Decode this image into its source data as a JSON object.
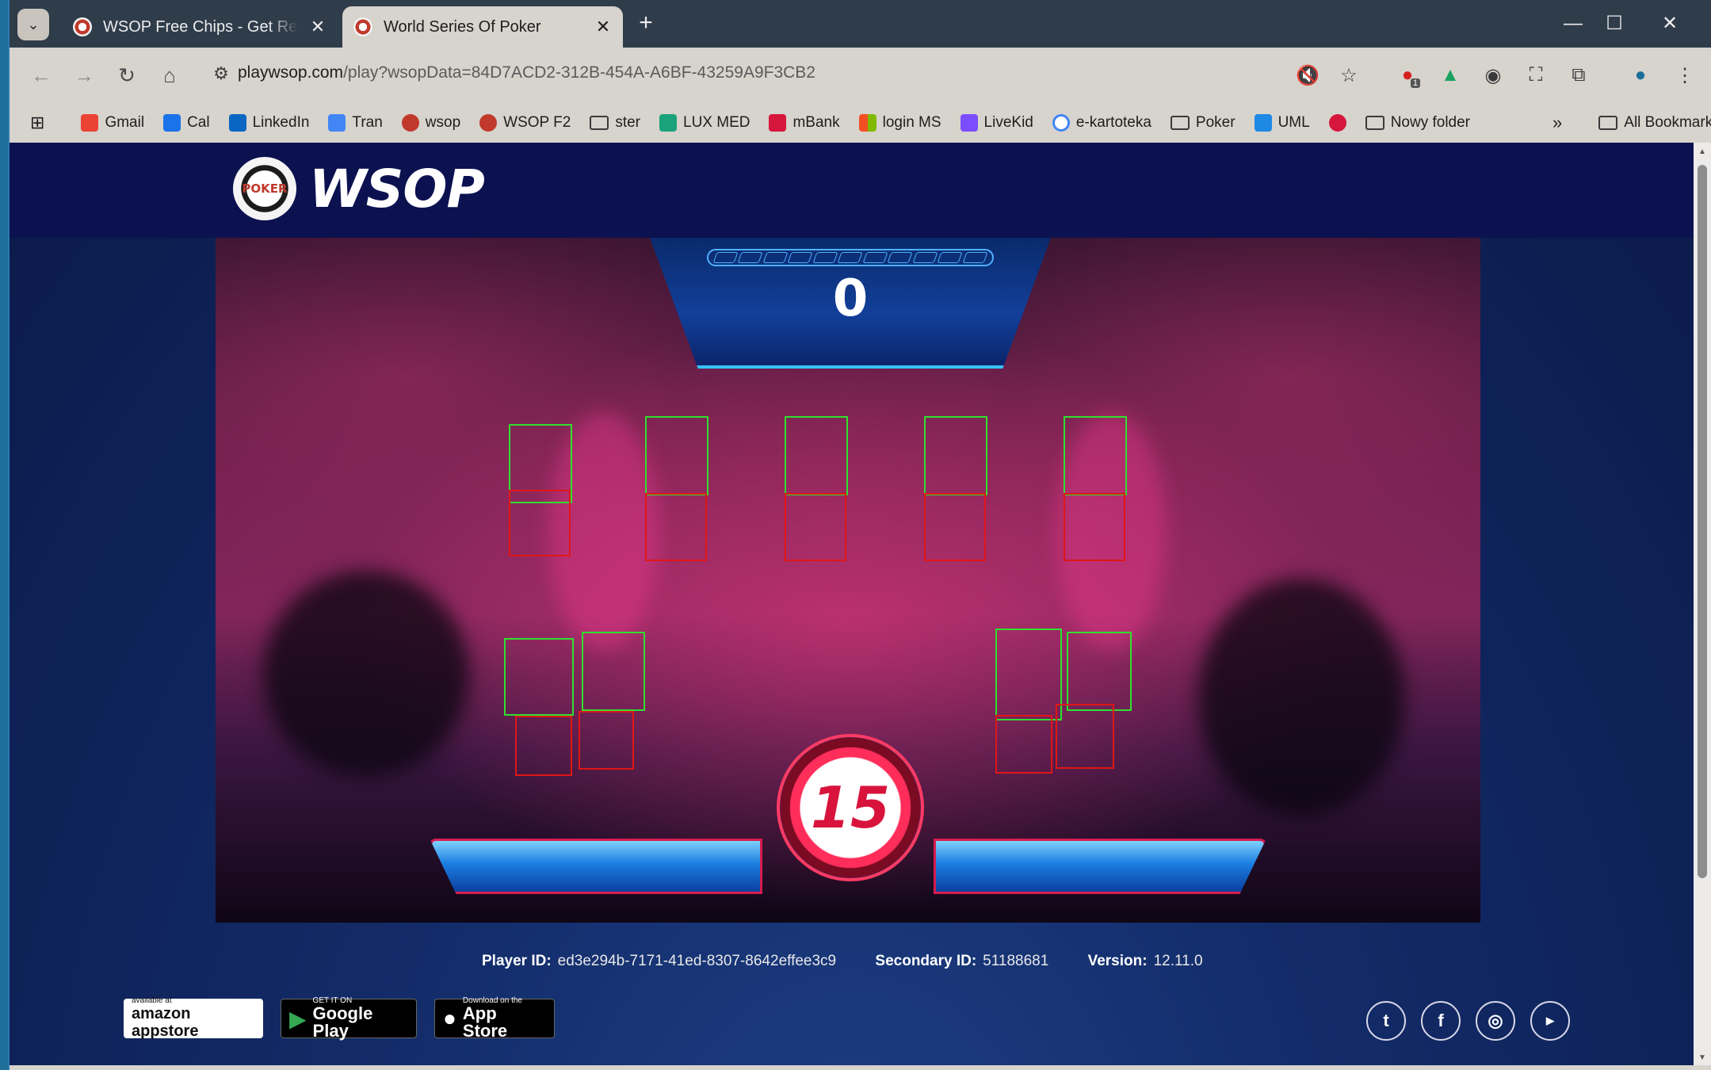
{
  "tabs": [
    {
      "title": "WSOP Free Chips - Get Rewards",
      "active": false
    },
    {
      "title": "World Series Of Poker",
      "active": true
    }
  ],
  "toolbar": {
    "url_host": "playwsop.com",
    "url_rest": "/play?wsopData=84D7ACD2-312B-454A-A6BF-43259A9F3CB2",
    "extension_badge": "1"
  },
  "bookmarks": [
    {
      "label": "Gmail",
      "color": "#ea4335"
    },
    {
      "label": "Cal",
      "color": "#1a73e8"
    },
    {
      "label": "LinkedIn",
      "color": "#0a66c2"
    },
    {
      "label": "Tran",
      "color": "#4285f4"
    },
    {
      "label": "wsop",
      "color": "#c0392b"
    },
    {
      "label": "WSOP F2",
      "color": "#c0392b"
    },
    {
      "label": "ster",
      "folder": true
    },
    {
      "label": "LUX MED",
      "color": "#1aa37a"
    },
    {
      "label": "mBank",
      "color": "#d6173d"
    },
    {
      "label": "login MS",
      "color": "#f25022"
    },
    {
      "label": "LiveKid",
      "color": "#7c4dff"
    },
    {
      "label": "e-kartoteka",
      "color": "#4285f4"
    },
    {
      "label": "Poker",
      "folder": true
    },
    {
      "label": "UML",
      "color": "#1e88e5"
    },
    {
      "label": "",
      "color": "#d6173d"
    },
    {
      "label": "Nowy folder",
      "folder": true
    }
  ],
  "bookmarks_all": "All Bookmarks",
  "brand": {
    "logo_text": "WSOP",
    "chip_text": "POKER"
  },
  "game": {
    "score": "0",
    "timer": "15"
  },
  "footer": {
    "player_id_label": "Player ID:",
    "player_id": "ed3e294b-7171-41ed-8307-8642effee3c9",
    "secondary_id_label": "Secondary ID:",
    "secondary_id": "51188681",
    "version_label": "Version:",
    "version": "12.11.0",
    "stores": [
      {
        "small": "available at",
        "big": "amazon appstore"
      },
      {
        "small": "GET IT ON",
        "big": "Google Play"
      },
      {
        "small": "Download on the",
        "big": "App Store"
      }
    ],
    "social": [
      "twitter-icon",
      "facebook-icon",
      "instagram-icon",
      "youtube-icon"
    ]
  }
}
